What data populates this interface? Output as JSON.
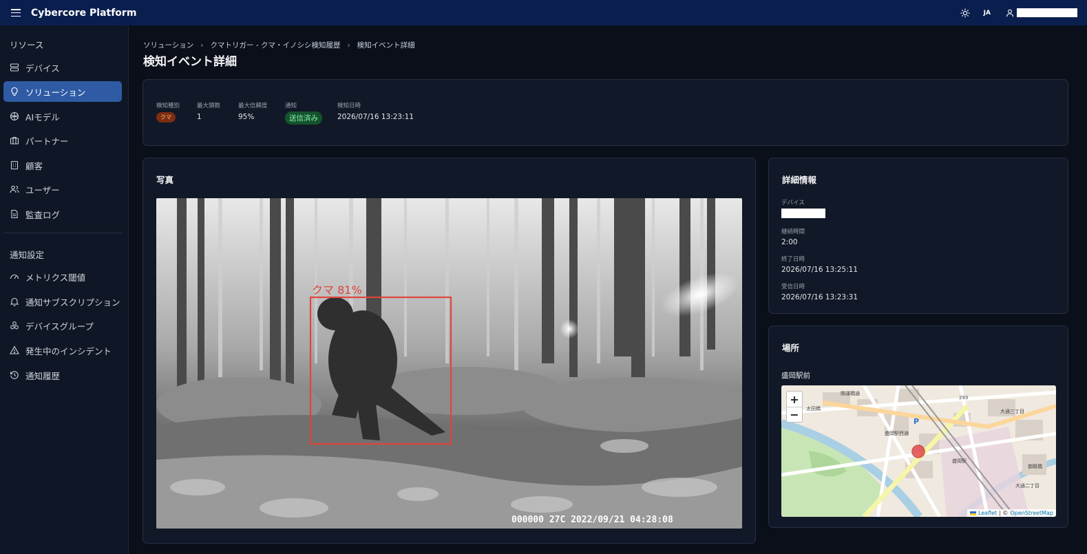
{
  "app": {
    "title": "Cybercore Platform",
    "lang": "JA"
  },
  "sidebar": {
    "resources_label": "リソース",
    "items": [
      {
        "label": "デバイス",
        "icon": "device-icon"
      },
      {
        "label": "ソリューション",
        "icon": "lightbulb-icon"
      },
      {
        "label": "AIモデル",
        "icon": "ai-model-icon"
      },
      {
        "label": "パートナー",
        "icon": "briefcase-icon"
      },
      {
        "label": "顧客",
        "icon": "building-icon"
      },
      {
        "label": "ユーザー",
        "icon": "users-icon"
      },
      {
        "label": "監査ログ",
        "icon": "document-icon"
      }
    ],
    "notify_label": "通知設定",
    "notify_items": [
      {
        "label": "メトリクス閾値",
        "icon": "gauge-icon"
      },
      {
        "label": "通知サブスクリプション",
        "icon": "bell-icon"
      },
      {
        "label": "デバイスグループ",
        "icon": "group-icon"
      },
      {
        "label": "発生中のインシデント",
        "icon": "warning-icon"
      },
      {
        "label": "通知履歴",
        "icon": "history-icon"
      }
    ]
  },
  "breadcrumb": {
    "items": [
      "ソリューション",
      "クマトリガー - クマ・イノシシ検知履歴",
      "検知イベント詳細"
    ],
    "separator": "›"
  },
  "page_title": "検知イベント詳細",
  "summary": {
    "type_label": "検知種別",
    "type_value": "クマ",
    "max_count_label": "最大頭数",
    "max_count_value": "1",
    "max_conf_label": "最大信頼度",
    "max_conf_value": "95%",
    "notify_label": "通知",
    "notify_value": "送信済み",
    "time_label": "検知日時",
    "time_value": "2026/07/16 13:23:11"
  },
  "photo": {
    "title": "写真",
    "detection_label": "クマ 81%",
    "overlay_text": "000000   27C   2022/09/21  04:28:08"
  },
  "details": {
    "title": "詳細情報",
    "device_label": "デバイス",
    "duration_label": "継続時間",
    "duration_value": "2:00",
    "end_label": "終了日時",
    "end_value": "2026/07/16 13:25:11",
    "received_label": "受信日時",
    "received_value": "2026/07/16 13:23:31"
  },
  "place": {
    "title": "場所",
    "name": "盛岡駅前",
    "zoom_in": "+",
    "zoom_out": "−",
    "attribution_leaflet": "Leaflet",
    "attribution_sep": "| ©",
    "attribution_osm": "OpenStreetMap",
    "map_labels": [
      "開運橋通",
      "大通三丁目",
      "盛岡駅西通",
      "太田橋",
      "盛岡駅",
      "293",
      "P",
      "大通二丁目",
      "御厩橋"
    ]
  },
  "colors": {
    "topbar": "#0b1f4f",
    "active_item": "#2f5ba5",
    "detection_box": "#e0453a",
    "badge_sent": "#14532d"
  }
}
